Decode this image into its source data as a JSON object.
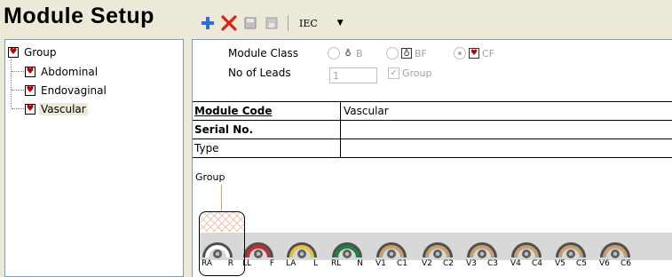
{
  "header": {
    "title": "Module Setup"
  },
  "toolbar": {
    "add_icon": "plus-icon",
    "delete_icon": "x-icon",
    "standard": "IEC"
  },
  "tree": {
    "root": {
      "label": "Group"
    },
    "children": [
      {
        "label": "Abdominal"
      },
      {
        "label": "Endovaginal"
      },
      {
        "label": "Vascular",
        "selected": true
      }
    ]
  },
  "form": {
    "module_class_label": "Module Class",
    "classes": [
      {
        "label": "B",
        "checked": false
      },
      {
        "label": "BF",
        "checked": false
      },
      {
        "label": "CF",
        "checked": true
      }
    ],
    "leads_label": "No of Leads",
    "leads_value": "1",
    "group_label": "Group",
    "group_checked": true
  },
  "grid": {
    "rows": [
      {
        "key": "Module Code",
        "value": "Vascular"
      },
      {
        "key": "Serial No.",
        "value": ""
      },
      {
        "key": "Type",
        "value": ""
      }
    ]
  },
  "canvas": {
    "group_caption": "Group",
    "leads": [
      {
        "name": "RA",
        "abbr": "R",
        "color": "#ffffff"
      },
      {
        "name": "LL",
        "abbr": "F",
        "color": "#c03030"
      },
      {
        "name": "LA",
        "abbr": "L",
        "color": "#e8c040"
      },
      {
        "name": "RL",
        "abbr": "N",
        "color": "#208040"
      },
      {
        "name": "V1",
        "abbr": "C1",
        "color": "#c8a070"
      },
      {
        "name": "V2",
        "abbr": "C2",
        "color": "#c8a070"
      },
      {
        "name": "V3",
        "abbr": "C3",
        "color": "#c8a070"
      },
      {
        "name": "V4",
        "abbr": "C4",
        "color": "#c8a070"
      },
      {
        "name": "V5",
        "abbr": "C5",
        "color": "#c8a070"
      },
      {
        "name": "V6",
        "abbr": "C6",
        "color": "#c8a070"
      }
    ]
  },
  "colors": {
    "accent_blue": "#2d6fd8",
    "delete_red": "#e02010",
    "selection": "#ece9d8"
  }
}
